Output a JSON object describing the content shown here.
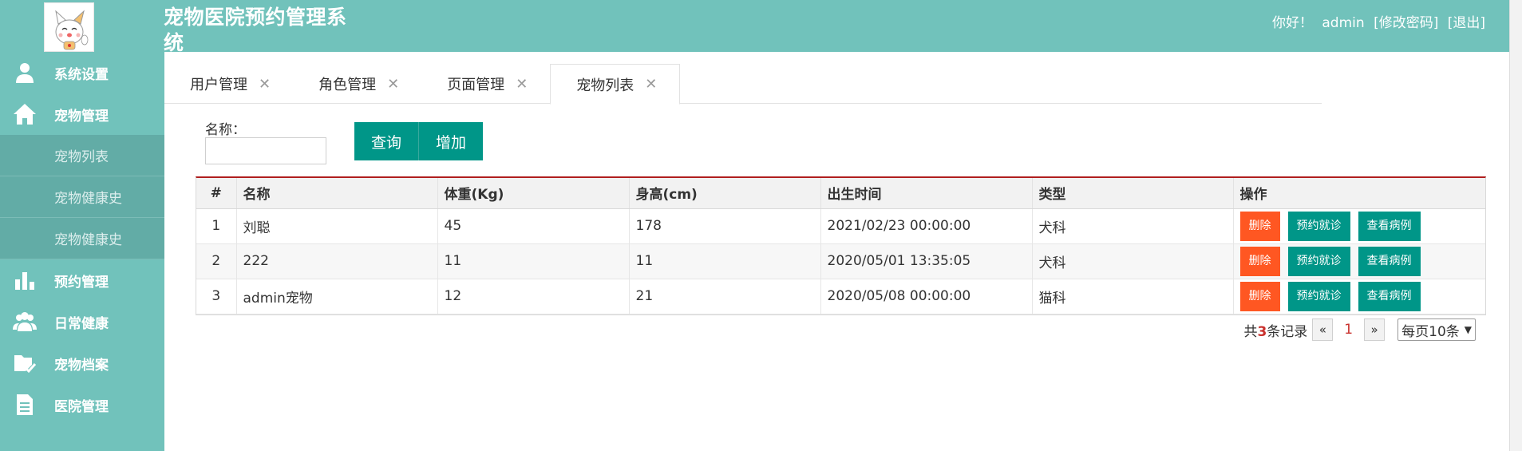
{
  "header": {
    "app_title": "宠物医院预约管理系统",
    "greeting": "你好！",
    "username": "admin",
    "change_password": "[修改密码]",
    "logout": "[退出]",
    "brand_color": "#71c2bb"
  },
  "sidebar": {
    "items": [
      {
        "label": "系统设置",
        "icon": "user-icon"
      },
      {
        "label": "宠物管理",
        "icon": "home-icon"
      },
      {
        "label": "预约管理",
        "icon": "bar-chart-icon"
      },
      {
        "label": "日常健康",
        "icon": "group-icon"
      },
      {
        "label": "宠物档案",
        "icon": "folder-check-icon"
      },
      {
        "label": "医院管理",
        "icon": "document-icon"
      }
    ],
    "sub_items": [
      "宠物列表",
      "宠物健康史",
      "宠物健康史"
    ]
  },
  "tabs": [
    {
      "label": "用户管理"
    },
    {
      "label": "角色管理"
    },
    {
      "label": "页面管理"
    },
    {
      "label": "宠物列表"
    }
  ],
  "tab_close_glyph": "✕",
  "search": {
    "label": "名称：",
    "value": "",
    "query_button": "查询",
    "add_button": "增加"
  },
  "table": {
    "columns": [
      "#",
      "名称",
      "体重(Kg)",
      "身高(cm)",
      "出生时间",
      "类型",
      "操作"
    ],
    "rows": [
      {
        "index": "1",
        "name": "刘聪",
        "weight": "45",
        "height": "178",
        "birth": "2021/02/23 00:00:00",
        "type": "犬科"
      },
      {
        "index": "2",
        "name": "222",
        "weight": "11",
        "height": "11",
        "birth": "2020/05/01 13:35:05",
        "type": "犬科"
      },
      {
        "index": "3",
        "name": "admin宠物",
        "weight": "12",
        "height": "21",
        "birth": "2020/05/08 00:00:00",
        "type": "猫科"
      }
    ],
    "actions": {
      "delete": "删除",
      "appointment": "预约就诊",
      "records": "查看病例"
    }
  },
  "pager": {
    "prefix": "共",
    "total": "3",
    "suffix": "条记录",
    "prev": "«",
    "current": "1",
    "next": "»",
    "page_size": "每页10条"
  }
}
